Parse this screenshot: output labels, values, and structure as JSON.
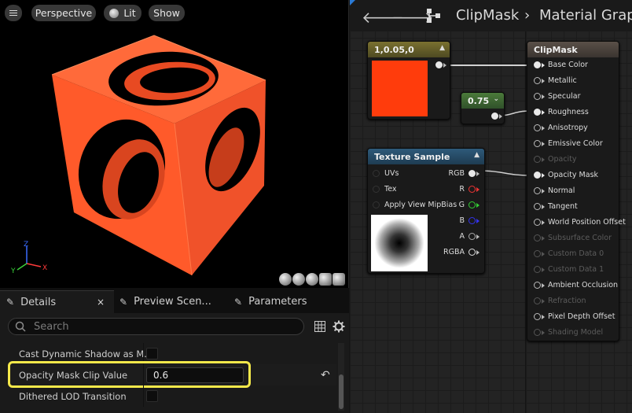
{
  "viewport": {
    "buttons": {
      "perspective": "Perspective",
      "lit": "Lit",
      "show": "Show"
    },
    "axis": {
      "x": "X",
      "y": "Y",
      "z": "Z"
    },
    "cube_color": "#ff5a2a"
  },
  "details": {
    "tabs": [
      "Details",
      "Preview Scen...",
      "Parameters"
    ],
    "close": "×",
    "search_placeholder": "Search",
    "properties": [
      {
        "name": "Cast Dynamic Shadow as M...",
        "type": "checkbox",
        "checked": false
      },
      {
        "name": "Opacity Mask Clip Value",
        "type": "number",
        "value": "0.6",
        "highlighted": true
      },
      {
        "name": "Dithered LOD Transition",
        "type": "checkbox",
        "checked": false
      }
    ],
    "reset_icon": "↶",
    "highlight_color": "#f4e84a"
  },
  "graph": {
    "breadcrumb": {
      "asset": "ClipMask",
      "separator": "›",
      "view": "Material Grap"
    },
    "constant3": {
      "title": "1,0.05,0",
      "color": "#ff3c0c"
    },
    "constant": {
      "title": "0.75"
    },
    "texture": {
      "title": "Texture Sample",
      "inputs": [
        "UVs",
        "Tex",
        "Apply View MipBias"
      ],
      "outputs": [
        "RGB",
        "R",
        "G",
        "B",
        "A",
        "RGBA"
      ]
    },
    "result": {
      "title": "ClipMask",
      "pins": [
        {
          "label": "Base Color",
          "active": true,
          "connected": true
        },
        {
          "label": "Metallic",
          "active": true,
          "connected": false
        },
        {
          "label": "Specular",
          "active": true,
          "connected": false
        },
        {
          "label": "Roughness",
          "active": true,
          "connected": true
        },
        {
          "label": "Anisotropy",
          "active": true,
          "connected": false
        },
        {
          "label": "Emissive Color",
          "active": true,
          "connected": false
        },
        {
          "label": "Opacity",
          "active": false,
          "connected": false
        },
        {
          "label": "Opacity Mask",
          "active": true,
          "connected": true
        },
        {
          "label": "Normal",
          "active": true,
          "connected": false
        },
        {
          "label": "Tangent",
          "active": true,
          "connected": false
        },
        {
          "label": "World Position Offset",
          "active": true,
          "connected": false
        },
        {
          "label": "Subsurface Color",
          "active": false,
          "connected": false
        },
        {
          "label": "Custom Data 0",
          "active": false,
          "connected": false
        },
        {
          "label": "Custom Data 1",
          "active": false,
          "connected": false
        },
        {
          "label": "Ambient Occlusion",
          "active": true,
          "connected": false
        },
        {
          "label": "Refraction",
          "active": false,
          "connected": false
        },
        {
          "label": "Pixel Depth Offset",
          "active": true,
          "connected": false
        },
        {
          "label": "Shading Model",
          "active": false,
          "connected": false
        }
      ]
    }
  }
}
